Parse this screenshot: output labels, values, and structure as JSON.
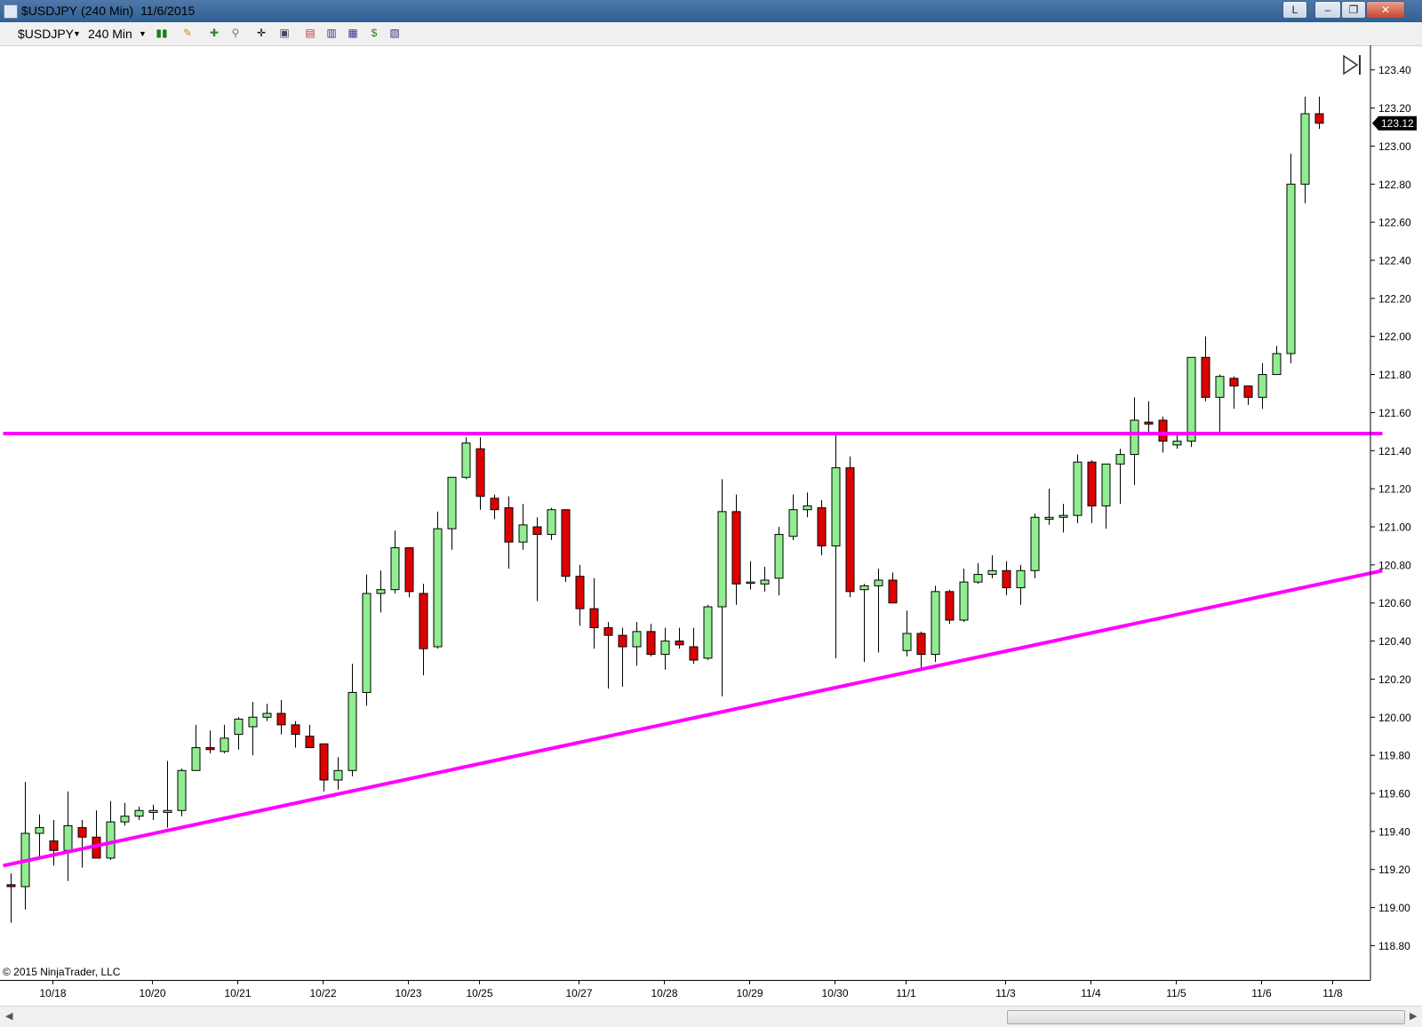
{
  "window": {
    "symbol": "$USDJPY",
    "interval": "(240 Min)",
    "date": "11/6/2015",
    "buttons": {
      "link": "L",
      "minimize": "‒",
      "restore": "❐",
      "close": "✕"
    }
  },
  "toolbar": {
    "instrument": "$USDJPY",
    "period": "240 Min",
    "icons": [
      "bar-type-icon",
      "drawing-pen-icon",
      "add-indicator-icon",
      "zoom-icon",
      "crosshair-icon",
      "data-box-icon",
      "strategy-icon",
      "chart-properties-icon",
      "performance-icon",
      "dollar-icon",
      "template-icon"
    ]
  },
  "copyright": "© 2015 NinjaTrader, LLC",
  "colors": {
    "up": "#90ee90",
    "down": "#e00000",
    "trendline": "#ff00ff",
    "axis": "#000000",
    "last_price_bg": "#000000"
  },
  "chart_data": {
    "type": "candlestick",
    "title": "",
    "xlabel": "",
    "ylabel": "",
    "ylim": [
      118.62,
      123.52
    ],
    "y_ticks": [
      "118.80",
      "119.00",
      "119.20",
      "119.40",
      "119.60",
      "119.80",
      "120.00",
      "120.20",
      "120.40",
      "120.60",
      "120.80",
      "121.00",
      "121.20",
      "121.40",
      "121.60",
      "121.80",
      "122.00",
      "122.20",
      "122.40",
      "122.60",
      "122.80",
      "123.00",
      "123.20",
      "123.40"
    ],
    "x_ticks": [
      {
        "label": "10/18",
        "bar": 3
      },
      {
        "label": "10/20",
        "bar": 10
      },
      {
        "label": "10/21",
        "bar": 16
      },
      {
        "label": "10/22",
        "bar": 22
      },
      {
        "label": "10/23",
        "bar": 28
      },
      {
        "label": "10/25",
        "bar": 33
      },
      {
        "label": "10/27",
        "bar": 40
      },
      {
        "label": "10/28",
        "bar": 46
      },
      {
        "label": "10/29",
        "bar": 52
      },
      {
        "label": "10/30",
        "bar": 58
      },
      {
        "label": "11/1",
        "bar": 63
      },
      {
        "label": "11/3",
        "bar": 70
      },
      {
        "label": "11/4",
        "bar": 76
      },
      {
        "label": "11/5",
        "bar": 82
      },
      {
        "label": "11/6",
        "bar": 88
      },
      {
        "label": "11/8",
        "bar": 93
      }
    ],
    "last_price": "123.12",
    "candles": [
      {
        "o": 119.12,
        "h": 119.18,
        "l": 118.92,
        "c": 119.11
      },
      {
        "o": 119.11,
        "h": 119.66,
        "l": 118.99,
        "c": 119.39
      },
      {
        "o": 119.39,
        "h": 119.49,
        "l": 119.27,
        "c": 119.42
      },
      {
        "o": 119.35,
        "h": 119.46,
        "l": 119.22,
        "c": 119.3
      },
      {
        "o": 119.3,
        "h": 119.61,
        "l": 119.14,
        "c": 119.43
      },
      {
        "o": 119.42,
        "h": 119.46,
        "l": 119.21,
        "c": 119.37
      },
      {
        "o": 119.37,
        "h": 119.51,
        "l": 119.26,
        "c": 119.26
      },
      {
        "o": 119.26,
        "h": 119.56,
        "l": 119.25,
        "c": 119.45
      },
      {
        "o": 119.45,
        "h": 119.55,
        "l": 119.43,
        "c": 119.48
      },
      {
        "o": 119.48,
        "h": 119.53,
        "l": 119.46,
        "c": 119.51
      },
      {
        "o": 119.5,
        "h": 119.54,
        "l": 119.46,
        "c": 119.51
      },
      {
        "o": 119.5,
        "h": 119.77,
        "l": 119.42,
        "c": 119.51
      },
      {
        "o": 119.51,
        "h": 119.73,
        "l": 119.48,
        "c": 119.72
      },
      {
        "o": 119.72,
        "h": 119.96,
        "l": 119.72,
        "c": 119.84
      },
      {
        "o": 119.84,
        "h": 119.93,
        "l": 119.81,
        "c": 119.83
      },
      {
        "o": 119.82,
        "h": 119.96,
        "l": 119.81,
        "c": 119.89
      },
      {
        "o": 119.91,
        "h": 120.0,
        "l": 119.83,
        "c": 119.99
      },
      {
        "o": 119.95,
        "h": 120.08,
        "l": 119.8,
        "c": 120.0
      },
      {
        "o": 120.0,
        "h": 120.07,
        "l": 119.98,
        "c": 120.02
      },
      {
        "o": 120.02,
        "h": 120.09,
        "l": 119.91,
        "c": 119.96
      },
      {
        "o": 119.96,
        "h": 119.98,
        "l": 119.84,
        "c": 119.91
      },
      {
        "o": 119.9,
        "h": 119.96,
        "l": 119.84,
        "c": 119.84
      },
      {
        "o": 119.86,
        "h": 119.86,
        "l": 119.61,
        "c": 119.67
      },
      {
        "o": 119.67,
        "h": 119.79,
        "l": 119.62,
        "c": 119.72
      },
      {
        "o": 119.72,
        "h": 120.28,
        "l": 119.69,
        "c": 120.13
      },
      {
        "o": 120.13,
        "h": 120.75,
        "l": 120.06,
        "c": 120.65
      },
      {
        "o": 120.65,
        "h": 120.77,
        "l": 120.55,
        "c": 120.67
      },
      {
        "o": 120.67,
        "h": 120.98,
        "l": 120.65,
        "c": 120.89
      },
      {
        "o": 120.89,
        "h": 120.89,
        "l": 120.63,
        "c": 120.66
      },
      {
        "o": 120.65,
        "h": 120.7,
        "l": 120.22,
        "c": 120.36
      },
      {
        "o": 120.37,
        "h": 121.08,
        "l": 120.36,
        "c": 120.99
      },
      {
        "o": 120.99,
        "h": 121.26,
        "l": 120.88,
        "c": 121.26
      },
      {
        "o": 121.26,
        "h": 121.47,
        "l": 121.25,
        "c": 121.44
      },
      {
        "o": 121.41,
        "h": 121.47,
        "l": 121.09,
        "c": 121.16
      },
      {
        "o": 121.15,
        "h": 121.17,
        "l": 121.04,
        "c": 121.09
      },
      {
        "o": 121.1,
        "h": 121.16,
        "l": 120.78,
        "c": 120.92
      },
      {
        "o": 120.92,
        "h": 121.12,
        "l": 120.88,
        "c": 121.01
      },
      {
        "o": 121.0,
        "h": 121.05,
        "l": 120.61,
        "c": 120.96
      },
      {
        "o": 120.96,
        "h": 121.1,
        "l": 120.93,
        "c": 121.09
      },
      {
        "o": 121.09,
        "h": 121.09,
        "l": 120.71,
        "c": 120.74
      },
      {
        "o": 120.74,
        "h": 120.8,
        "l": 120.48,
        "c": 120.57
      },
      {
        "o": 120.57,
        "h": 120.73,
        "l": 120.36,
        "c": 120.47
      },
      {
        "o": 120.47,
        "h": 120.5,
        "l": 120.15,
        "c": 120.43
      },
      {
        "o": 120.43,
        "h": 120.47,
        "l": 120.16,
        "c": 120.37
      },
      {
        "o": 120.37,
        "h": 120.5,
        "l": 120.27,
        "c": 120.45
      },
      {
        "o": 120.45,
        "h": 120.49,
        "l": 120.32,
        "c": 120.33
      },
      {
        "o": 120.33,
        "h": 120.47,
        "l": 120.25,
        "c": 120.4
      },
      {
        "o": 120.4,
        "h": 120.47,
        "l": 120.36,
        "c": 120.38
      },
      {
        "o": 120.37,
        "h": 120.47,
        "l": 120.28,
        "c": 120.3
      },
      {
        "o": 120.31,
        "h": 120.59,
        "l": 120.3,
        "c": 120.58
      },
      {
        "o": 120.58,
        "h": 121.25,
        "l": 120.11,
        "c": 121.08
      },
      {
        "o": 121.08,
        "h": 121.17,
        "l": 120.59,
        "c": 120.7
      },
      {
        "o": 120.71,
        "h": 120.82,
        "l": 120.67,
        "c": 120.71
      },
      {
        "o": 120.7,
        "h": 120.79,
        "l": 120.66,
        "c": 120.72
      },
      {
        "o": 120.73,
        "h": 121.0,
        "l": 120.64,
        "c": 120.96
      },
      {
        "o": 120.95,
        "h": 121.17,
        "l": 120.93,
        "c": 121.09
      },
      {
        "o": 121.09,
        "h": 121.18,
        "l": 121.05,
        "c": 121.11
      },
      {
        "o": 121.1,
        "h": 121.14,
        "l": 120.85,
        "c": 120.9
      },
      {
        "o": 120.9,
        "h": 121.48,
        "l": 120.31,
        "c": 121.31
      },
      {
        "o": 121.31,
        "h": 121.37,
        "l": 120.63,
        "c": 120.66
      },
      {
        "o": 120.67,
        "h": 120.7,
        "l": 120.29,
        "c": 120.69
      },
      {
        "o": 120.69,
        "h": 120.78,
        "l": 120.34,
        "c": 120.72
      },
      {
        "o": 120.72,
        "h": 120.76,
        "l": 120.65,
        "c": 120.6
      },
      {
        "o": 120.35,
        "h": 120.56,
        "l": 120.32,
        "c": 120.44
      },
      {
        "o": 120.44,
        "h": 120.45,
        "l": 120.25,
        "c": 120.33
      },
      {
        "o": 120.33,
        "h": 120.69,
        "l": 120.29,
        "c": 120.66
      },
      {
        "o": 120.66,
        "h": 120.67,
        "l": 120.49,
        "c": 120.51
      },
      {
        "o": 120.51,
        "h": 120.78,
        "l": 120.5,
        "c": 120.71
      },
      {
        "o": 120.71,
        "h": 120.81,
        "l": 120.7,
        "c": 120.75
      },
      {
        "o": 120.75,
        "h": 120.85,
        "l": 120.73,
        "c": 120.77
      },
      {
        "o": 120.77,
        "h": 120.82,
        "l": 120.64,
        "c": 120.68
      },
      {
        "o": 120.68,
        "h": 120.8,
        "l": 120.59,
        "c": 120.77
      },
      {
        "o": 120.77,
        "h": 121.07,
        "l": 120.73,
        "c": 121.05
      },
      {
        "o": 121.04,
        "h": 121.2,
        "l": 121.01,
        "c": 121.05
      },
      {
        "o": 121.05,
        "h": 121.12,
        "l": 120.97,
        "c": 121.06
      },
      {
        "o": 121.06,
        "h": 121.38,
        "l": 121.02,
        "c": 121.34
      },
      {
        "o": 121.34,
        "h": 121.35,
        "l": 121.02,
        "c": 121.11
      },
      {
        "o": 121.11,
        "h": 121.33,
        "l": 120.99,
        "c": 121.33
      },
      {
        "o": 121.33,
        "h": 121.41,
        "l": 121.12,
        "c": 121.38
      },
      {
        "o": 121.38,
        "h": 121.68,
        "l": 121.22,
        "c": 121.56
      },
      {
        "o": 121.55,
        "h": 121.66,
        "l": 121.48,
        "c": 121.54
      },
      {
        "o": 121.56,
        "h": 121.58,
        "l": 121.39,
        "c": 121.45
      },
      {
        "o": 121.43,
        "h": 121.49,
        "l": 121.41,
        "c": 121.45
      },
      {
        "o": 121.45,
        "h": 121.89,
        "l": 121.42,
        "c": 121.89
      },
      {
        "o": 121.89,
        "h": 122.0,
        "l": 121.66,
        "c": 121.68
      },
      {
        "o": 121.68,
        "h": 121.8,
        "l": 121.5,
        "c": 121.79
      },
      {
        "o": 121.78,
        "h": 121.79,
        "l": 121.62,
        "c": 121.74
      },
      {
        "o": 121.74,
        "h": 121.74,
        "l": 121.64,
        "c": 121.68
      },
      {
        "o": 121.68,
        "h": 121.86,
        "l": 121.62,
        "c": 121.8
      },
      {
        "o": 121.8,
        "h": 121.95,
        "l": 121.8,
        "c": 121.91
      },
      {
        "o": 121.91,
        "h": 122.96,
        "l": 121.86,
        "c": 122.8
      },
      {
        "o": 122.8,
        "h": 123.26,
        "l": 122.7,
        "c": 123.17
      },
      {
        "o": 123.17,
        "h": 123.26,
        "l": 123.09,
        "c": 123.12
      }
    ],
    "lines": [
      {
        "name": "resistance",
        "x1": -0.5,
        "y1": 121.49,
        "x2": 96.5,
        "y2": 121.49
      },
      {
        "name": "support-trendline",
        "x1": -0.5,
        "y1": 119.22,
        "x2": 96.5,
        "y2": 120.77
      }
    ]
  }
}
